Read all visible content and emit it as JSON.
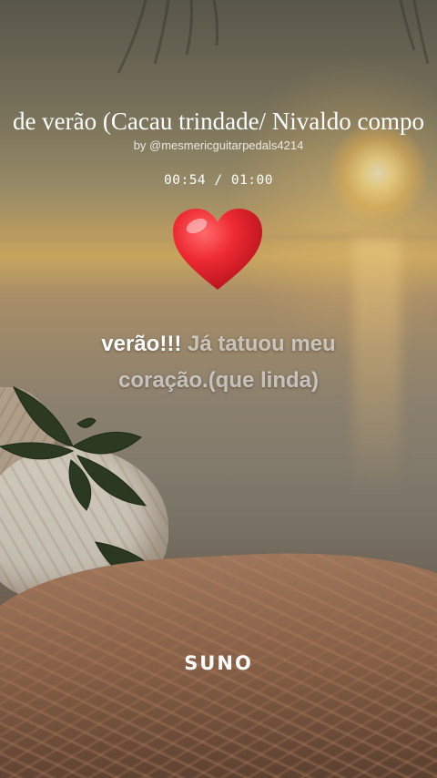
{
  "song": {
    "title": "de verão (Cacau trindade/ Nivaldo compo",
    "byline": "by @mesmericguitarpedals4214",
    "time_display": "00:54 / 01:00",
    "reaction_icon": "red-heart-emoji"
  },
  "lyrics": {
    "line1_sung": "verão!!!",
    "line1_unsung": " Já tatuou meu",
    "line2_unsung": "coração.(que linda)"
  },
  "branding": {
    "logo_text": "SUNO"
  },
  "colors": {
    "heart": "#e8202a",
    "sung_text": "#ffffff",
    "unsung_text": "rgba(255,255,255,0.6)"
  }
}
